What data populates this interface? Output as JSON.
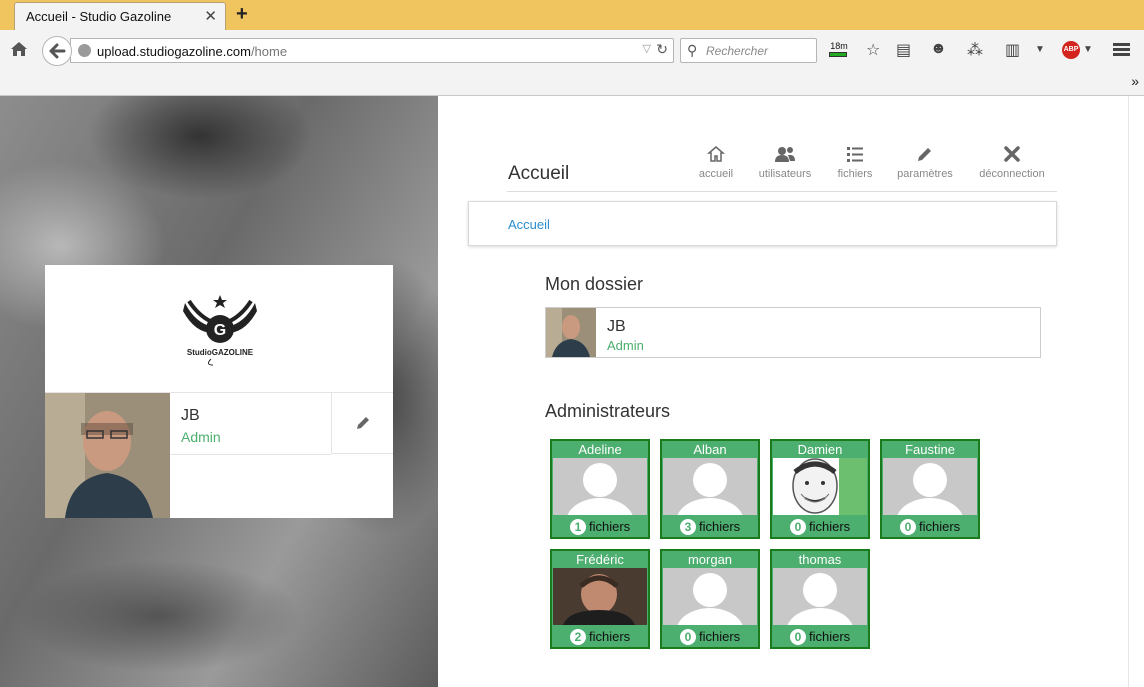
{
  "browser": {
    "tab_title": "Accueil - Studio Gazoline",
    "tab_close": "✕",
    "new_tab": "+",
    "url_host": "upload.studiogazoline.com",
    "url_path": "/home",
    "search_placeholder": "Rechercher",
    "timer": "18m",
    "abp": "ABP",
    "overflow": "»"
  },
  "header": {
    "title": "Accueil",
    "nav": [
      {
        "label": "accueil",
        "icon": "house-icon"
      },
      {
        "label": "utilisateurs",
        "icon": "users-icon"
      },
      {
        "label": "fichiers",
        "icon": "list-icon"
      },
      {
        "label": "paramètres",
        "icon": "pencil-icon"
      },
      {
        "label": "déconnection",
        "icon": "close-icon"
      }
    ]
  },
  "breadcrumb": {
    "link": "Accueil"
  },
  "profile": {
    "logo_text": "StudioGAZOLINE",
    "name": "JB",
    "role": "Admin"
  },
  "my_folder": {
    "title": "Mon dossier",
    "name": "JB",
    "role": "Admin"
  },
  "admins": {
    "title": "Administrateurs",
    "files_label": "fichiers",
    "tiles": [
      {
        "name": "Adeline",
        "count": "1",
        "photo": "placeholder"
      },
      {
        "name": "Alban",
        "count": "3",
        "photo": "placeholder"
      },
      {
        "name": "Damien",
        "count": "0",
        "photo": "drawing"
      },
      {
        "name": "Faustine",
        "count": "0",
        "photo": "placeholder"
      },
      {
        "name": "Frédéric",
        "count": "2",
        "photo": "photo"
      },
      {
        "name": "morgan",
        "count": "0",
        "photo": "placeholder"
      },
      {
        "name": "thomas",
        "count": "0",
        "photo": "placeholder"
      }
    ]
  },
  "colors": {
    "accent_green": "#4cae6f",
    "tile_border": "#1b7a1b",
    "link_blue": "#2a8ccf",
    "tabbar": "#f0c560"
  }
}
